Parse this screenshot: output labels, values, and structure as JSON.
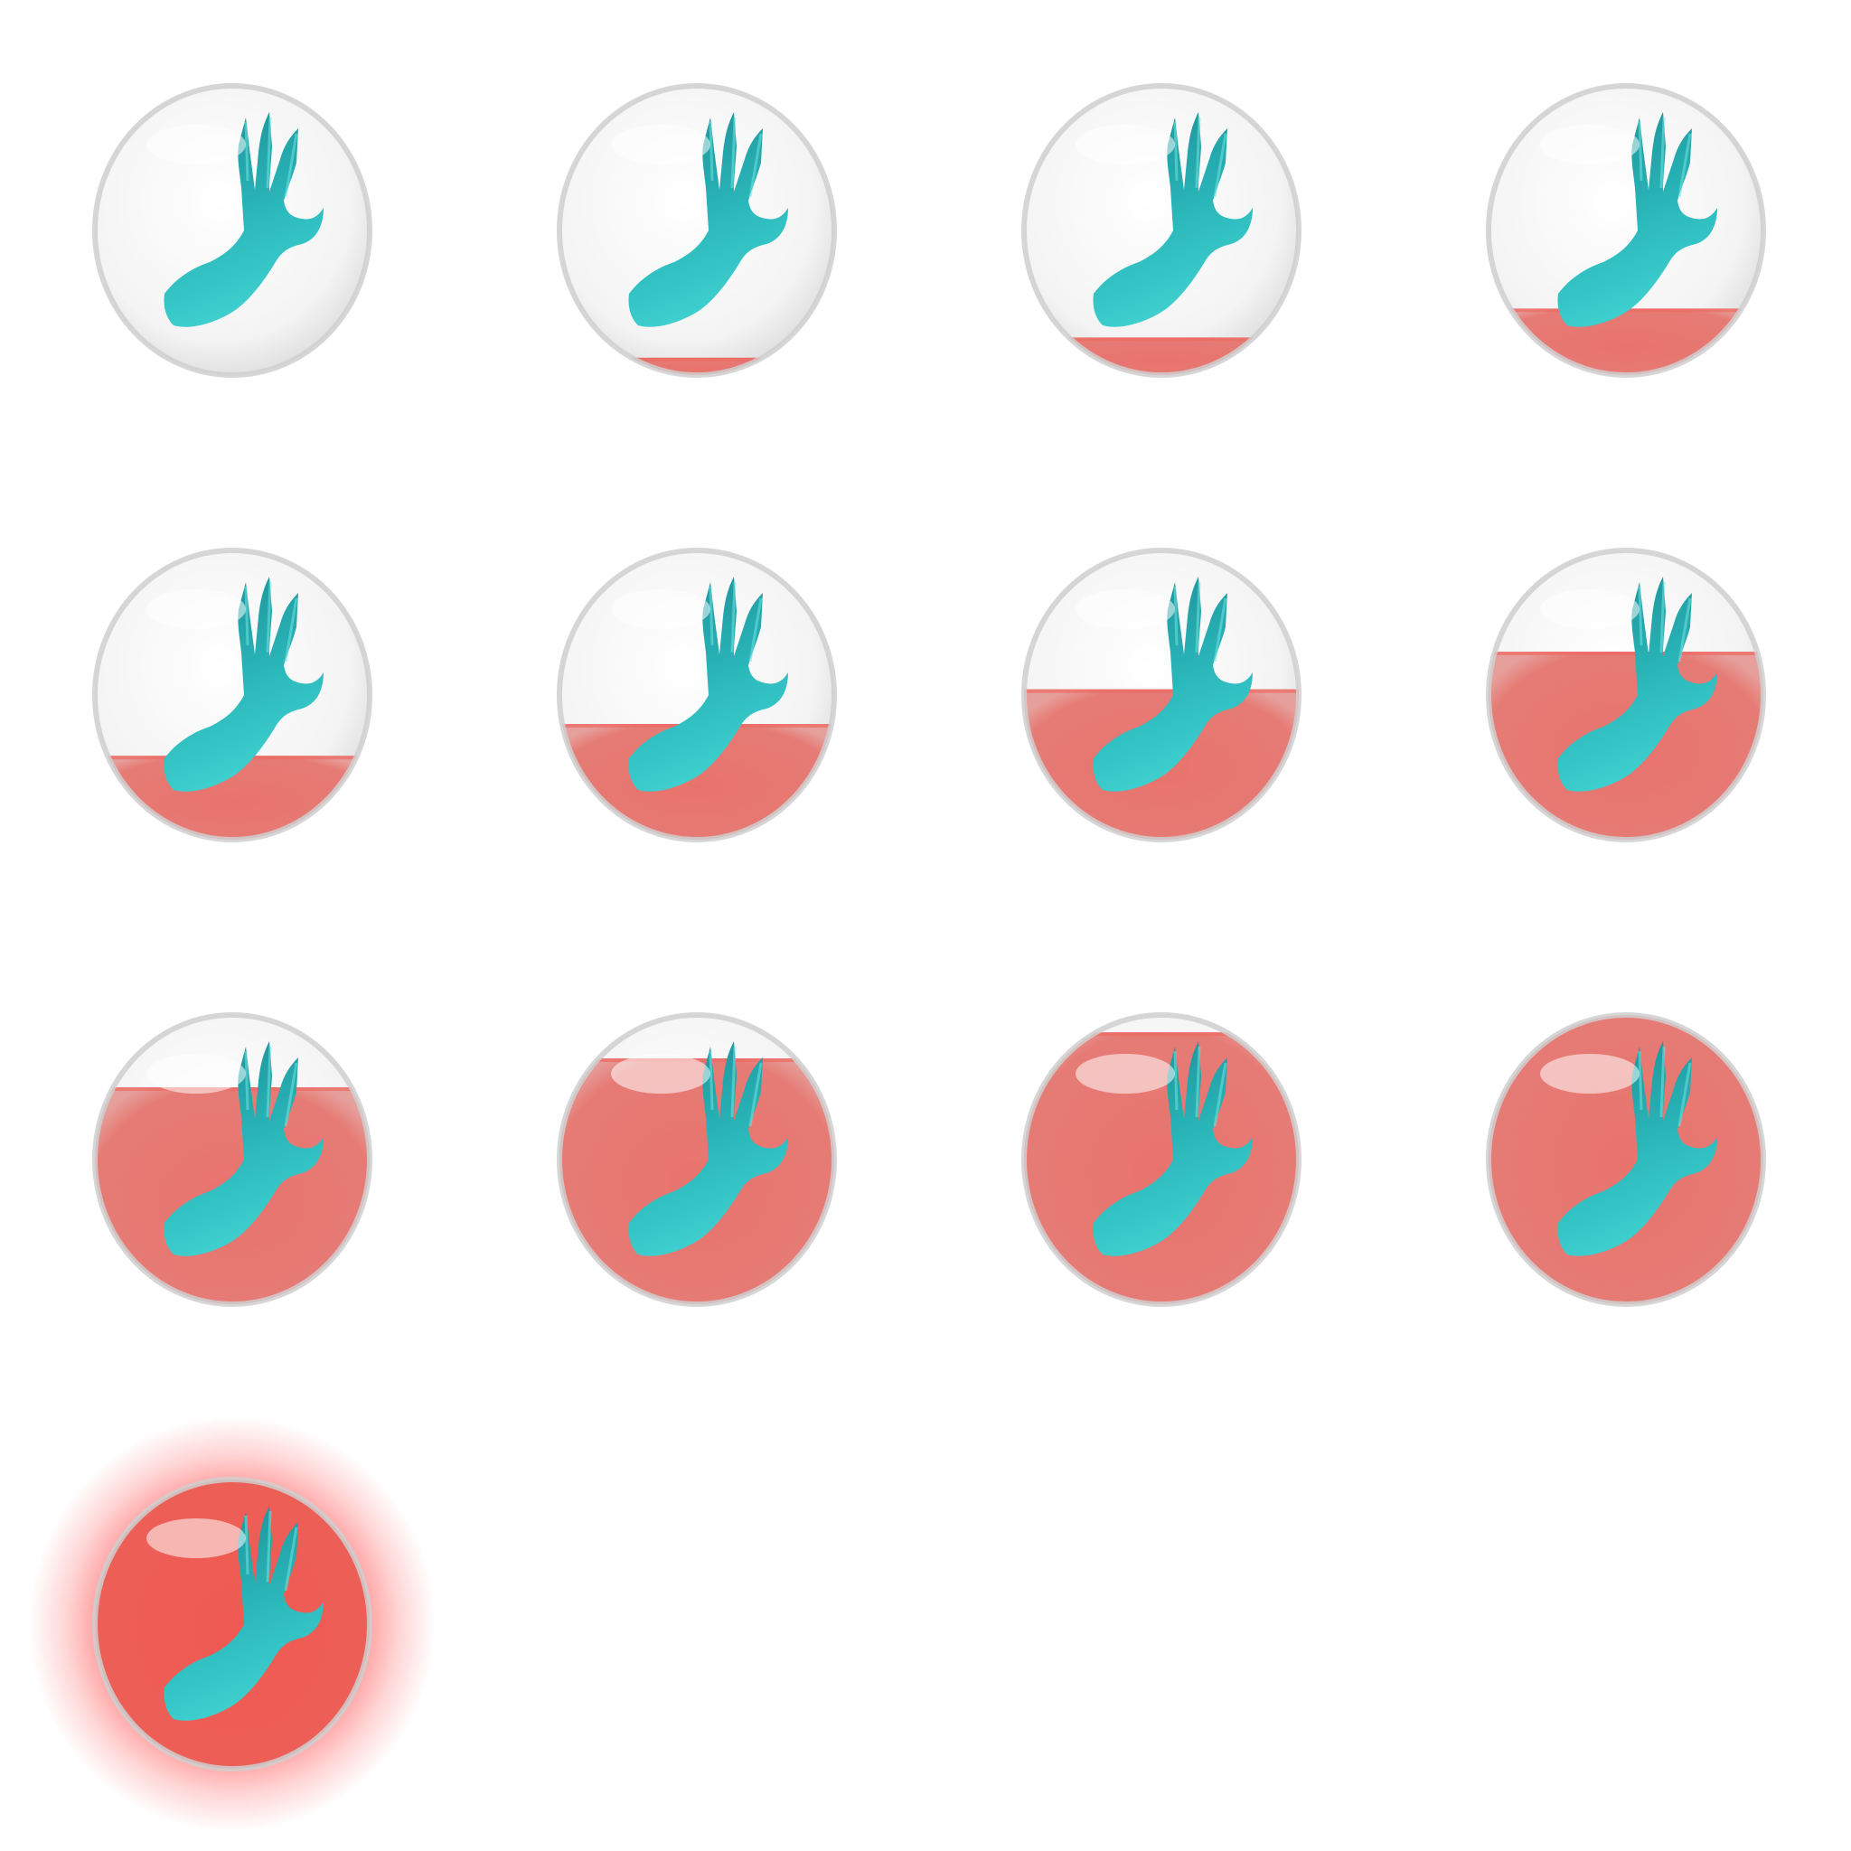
{
  "sprite_sheet": {
    "frame_count": 13,
    "columns": 4,
    "liquid_color": "#e8736d",
    "glass_color": "#f4f4f4",
    "rim_color": "#cfcfcf",
    "hand_color": "#2bb8bb",
    "hand_dark_color": "#1a8c93",
    "glow_color": "#ff3b3b",
    "icon": "claw-hand-icon",
    "frames": [
      {
        "fill": 0.0,
        "glow": false
      },
      {
        "fill": 0.06,
        "glow": false
      },
      {
        "fill": 0.13,
        "glow": false
      },
      {
        "fill": 0.23,
        "glow": false
      },
      {
        "fill": 0.29,
        "glow": false
      },
      {
        "fill": 0.4,
        "glow": false
      },
      {
        "fill": 0.52,
        "glow": false
      },
      {
        "fill": 0.65,
        "glow": false
      },
      {
        "fill": 0.75,
        "glow": false
      },
      {
        "fill": 0.85,
        "glow": false
      },
      {
        "fill": 0.94,
        "glow": false
      },
      {
        "fill": 1.0,
        "glow": false
      },
      {
        "fill": 1.0,
        "glow": true
      }
    ]
  }
}
